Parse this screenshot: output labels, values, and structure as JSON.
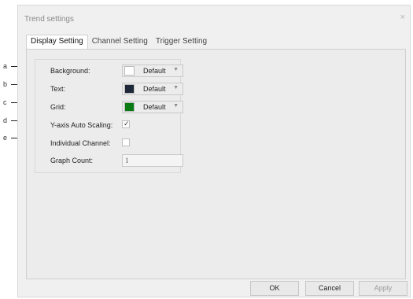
{
  "dialog": {
    "title": "Trend settings",
    "close_glyph": "×"
  },
  "tabs": [
    {
      "label": "Display Setting",
      "active": true
    },
    {
      "label": "Channel Setting",
      "active": false
    },
    {
      "label": "Trigger Setting",
      "active": false
    }
  ],
  "settings": {
    "background": {
      "label": "Background:",
      "value": "Default",
      "swatch_color": "#ffffff"
    },
    "text": {
      "label": "Text:",
      "value": "Default",
      "swatch_color": "#1c2838"
    },
    "grid": {
      "label": "Grid:",
      "value": "Default",
      "swatch_color": "#0a7a14"
    },
    "y_axis_auto_scaling": {
      "label": "Y-axis Auto Scaling:",
      "checked": true,
      "mark": "✓"
    },
    "individual_channel": {
      "label": "Individual Channel:",
      "checked": false
    },
    "graph_count": {
      "label": "Graph Count:",
      "value": "1"
    }
  },
  "dropdown_arrow": "▼",
  "buttons": {
    "ok": "OK",
    "cancel": "Cancel",
    "apply": "Apply"
  },
  "callouts": [
    "a",
    "b",
    "c",
    "d",
    "e"
  ]
}
